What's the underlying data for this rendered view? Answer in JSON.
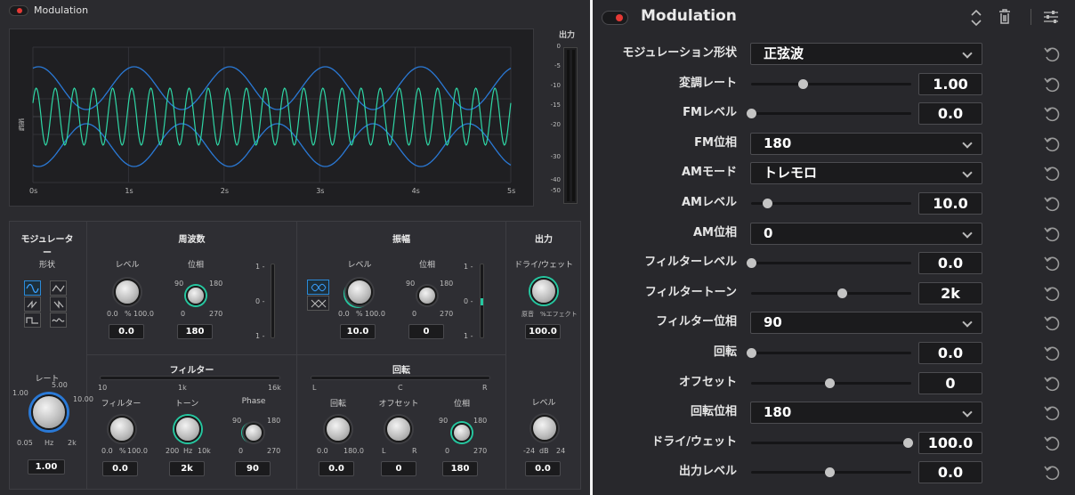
{
  "left": {
    "header_title": "Modulation",
    "meter": {
      "title": "出力",
      "scale": [
        "0",
        "-5",
        "-10",
        "-15",
        "-20",
        "-30",
        "-40",
        "-50"
      ]
    },
    "scope": {
      "time_ticks": [
        "0s",
        "1s",
        "2s",
        "3s",
        "4s",
        "5s"
      ],
      "side_label": "振幅"
    },
    "modulator": {
      "title": "モジュレーター",
      "shape_label": "形状",
      "rate_label": "レート",
      "rate_marks": {
        "min": "0.05",
        "unit": "Hz",
        "max": "2k",
        "a": "1.00",
        "b": "5.00",
        "c": "10.00"
      },
      "rate_value": "1.00"
    },
    "freq": {
      "title": "周波数",
      "level_label": "レベル",
      "level_min": "0.0",
      "level_unit": "%",
      "level_max": "100.0",
      "level_value": "0.0",
      "phase_label": "位相",
      "phase_marks": {
        "a": "90",
        "b": "180",
        "c": "0",
        "d": "270"
      },
      "phase_value": "180",
      "slider_marks": [
        "1 -",
        "0 -",
        "1 -"
      ]
    },
    "amp": {
      "title": "振幅",
      "level_label": "レベル",
      "level_min": "0.0",
      "level_unit": "%",
      "level_max": "100.0",
      "level_value": "10.0",
      "phase_label": "位相",
      "phase_marks": {
        "a": "90",
        "b": "180",
        "c": "0",
        "d": "270"
      },
      "phase_value": "0",
      "slider_marks": [
        "1 -",
        "0 -",
        "1 -"
      ]
    },
    "out": {
      "title": "出力",
      "drywet_label": "ドライ/ウェット",
      "drywet_min": "原音",
      "drywet_max": "%エフェクト",
      "drywet_value": "100.0",
      "level_label": "レベル",
      "level_min": "-24",
      "level_unit": "dB",
      "level_max": "24",
      "level_value": "0.0"
    },
    "filter": {
      "title": "フィルター",
      "scale": [
        "10",
        "1k",
        "16k"
      ],
      "f_label": "フィルター",
      "f_min": "0.0",
      "f_unit": "%",
      "f_max": "100.0",
      "f_value": "0.0",
      "tone_label": "トーン",
      "tone_min": "200",
      "tone_unit": "Hz",
      "tone_max": "10k",
      "tone_value": "2k",
      "phase_label": "Phase",
      "phase_marks": {
        "a": "90",
        "b": "180",
        "c": "0",
        "d": "270"
      },
      "phase_value": "90"
    },
    "rot": {
      "title": "回転",
      "scale": [
        "L",
        "C",
        "R"
      ],
      "rot_label": "回転",
      "rot_min": "0.0",
      "rot_max": "180.0",
      "rot_value": "0.0",
      "off_label": "オフセット",
      "off_min": "L",
      "off_max": "R",
      "off_value": "0",
      "phase_label": "位相",
      "phase_marks": {
        "a": "90",
        "b": "180",
        "c": "0",
        "d": "270"
      },
      "phase_value": "180"
    }
  },
  "right": {
    "header_title": "Modulation",
    "rows": [
      {
        "label": "モジュレーション形状",
        "type": "dropdown",
        "value": "正弦波"
      },
      {
        "label": "変調レート",
        "type": "slider",
        "value": "1.00",
        "pos": 0.33
      },
      {
        "label": "FMレベル",
        "type": "slider",
        "value": "0.0",
        "pos": 0.0
      },
      {
        "label": "FM位相",
        "type": "dropdown",
        "value": "180"
      },
      {
        "label": "AMモード",
        "type": "dropdown",
        "value": "トレモロ"
      },
      {
        "label": "AMレベル",
        "type": "slider",
        "value": "10.0",
        "pos": 0.1
      },
      {
        "label": "AM位相",
        "type": "dropdown",
        "value": "0"
      },
      {
        "label": "フィルターレベル",
        "type": "slider",
        "value": "0.0",
        "pos": 0.0
      },
      {
        "label": "フィルタートーン",
        "type": "slider",
        "value": "2k",
        "pos": 0.58
      },
      {
        "label": "フィルター位相",
        "type": "dropdown",
        "value": "90"
      },
      {
        "label": "回転",
        "type": "slider",
        "value": "0.0",
        "pos": 0.0
      },
      {
        "label": "オフセット",
        "type": "slider",
        "value": "0",
        "pos": 0.5
      },
      {
        "label": "回転位相",
        "type": "dropdown",
        "value": "180"
      },
      {
        "label": "ドライ/ウェット",
        "type": "slider",
        "value": "100.0",
        "pos": 1.0
      },
      {
        "label": "出力レベル",
        "type": "slider",
        "value": "0.0",
        "pos": 0.5
      }
    ]
  },
  "colors": {
    "accent_teal": "#25c7a0",
    "accent_blue": "#2a79d6",
    "power_red": "#e53935"
  }
}
